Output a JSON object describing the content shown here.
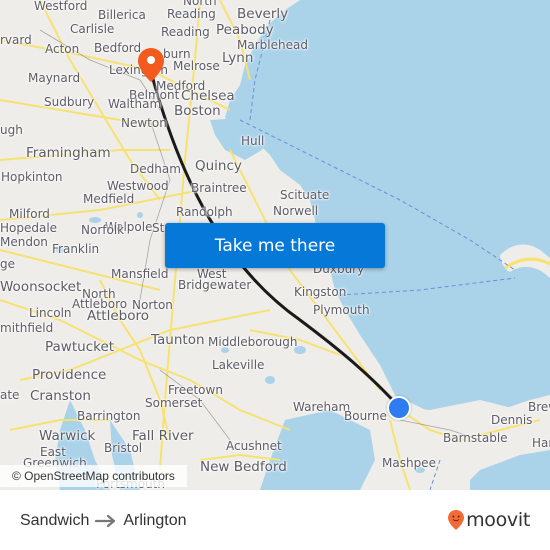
{
  "map": {
    "cta_label": "Take me there",
    "attribution": "© OpenStreetMap contributors",
    "colors": {
      "land": "#efede9",
      "water": "#aad3ea",
      "roads": "#f7e26b",
      "route_line": "#1a1a1a",
      "origin_dot": "#2f7bf2",
      "dest_pin": "#f25a1e",
      "cta": "#0679d8"
    },
    "places": [
      {
        "name": "Westford"
      },
      {
        "name": "North"
      },
      {
        "name": "Billerica"
      },
      {
        "name": "Reading"
      },
      {
        "name": "Beverly"
      },
      {
        "name": "rvard"
      },
      {
        "name": "Carlisle"
      },
      {
        "name": "Reading"
      },
      {
        "name": "Peabody"
      },
      {
        "name": "Marblehead"
      },
      {
        "name": "Acton"
      },
      {
        "name": "Bedford"
      },
      {
        "name": "burn"
      },
      {
        "name": "Lynn"
      },
      {
        "name": "Melrose"
      },
      {
        "name": "Maynard"
      },
      {
        "name": "Lexington"
      },
      {
        "name": "Medford"
      },
      {
        "name": "Chelsea"
      },
      {
        "name": "Sudbury"
      },
      {
        "name": "Belmont"
      },
      {
        "name": "Waltham"
      },
      {
        "name": "Boston"
      },
      {
        "name": "Newton"
      },
      {
        "name": "Hull"
      },
      {
        "name": "ugh"
      },
      {
        "name": "Framingham"
      },
      {
        "name": "Quincy"
      },
      {
        "name": "Dedham"
      },
      {
        "name": "Hopkinton"
      },
      {
        "name": "Westwood"
      },
      {
        "name": "Braintree"
      },
      {
        "name": "Scituate"
      },
      {
        "name": "Medfield"
      },
      {
        "name": "Randolph"
      },
      {
        "name": "Norwell"
      },
      {
        "name": "Milford"
      },
      {
        "name": "Walpole"
      },
      {
        "name": "Hopedale"
      },
      {
        "name": "Norfolk"
      },
      {
        "name": "Sto"
      },
      {
        "name": "Mendon"
      },
      {
        "name": "Franklin"
      },
      {
        "name": "ge"
      },
      {
        "name": "Mansfield"
      },
      {
        "name": "West"
      },
      {
        "name": "Duxbury"
      },
      {
        "name": "Bridgewater"
      },
      {
        "name": "Woonsocket"
      },
      {
        "name": "North"
      },
      {
        "name": "Kingston"
      },
      {
        "name": "Attleboro"
      },
      {
        "name": "Norton"
      },
      {
        "name": "Lincoln"
      },
      {
        "name": "Attleboro"
      },
      {
        "name": "Plymouth"
      },
      {
        "name": "mithfield"
      },
      {
        "name": "Taunton"
      },
      {
        "name": "Middleborough"
      },
      {
        "name": "Pawtucket"
      },
      {
        "name": "Lakeville"
      },
      {
        "name": "Providence"
      },
      {
        "name": "Freetown"
      },
      {
        "name": "ate"
      },
      {
        "name": "Cranston"
      },
      {
        "name": "Somerset"
      },
      {
        "name": "Wareham"
      },
      {
        "name": "Bourne"
      },
      {
        "name": "Brew"
      },
      {
        "name": "Barrington"
      },
      {
        "name": "Dennis"
      },
      {
        "name": "Warwick"
      },
      {
        "name": "Fall River"
      },
      {
        "name": "Barnstable"
      },
      {
        "name": "Har"
      },
      {
        "name": "East"
      },
      {
        "name": "Bristol"
      },
      {
        "name": "Acushnet"
      },
      {
        "name": "Greenwich"
      },
      {
        "name": "New Bedford"
      },
      {
        "name": "Mashpee"
      },
      {
        "name": "Portsmouth"
      }
    ],
    "origin_marker": "origin-dot",
    "destination_marker": "map-pin"
  },
  "footer": {
    "origin": "Sandwich",
    "destination": "Arlington",
    "arrow_icon": "arrow-right-icon",
    "brand": "moovit"
  }
}
